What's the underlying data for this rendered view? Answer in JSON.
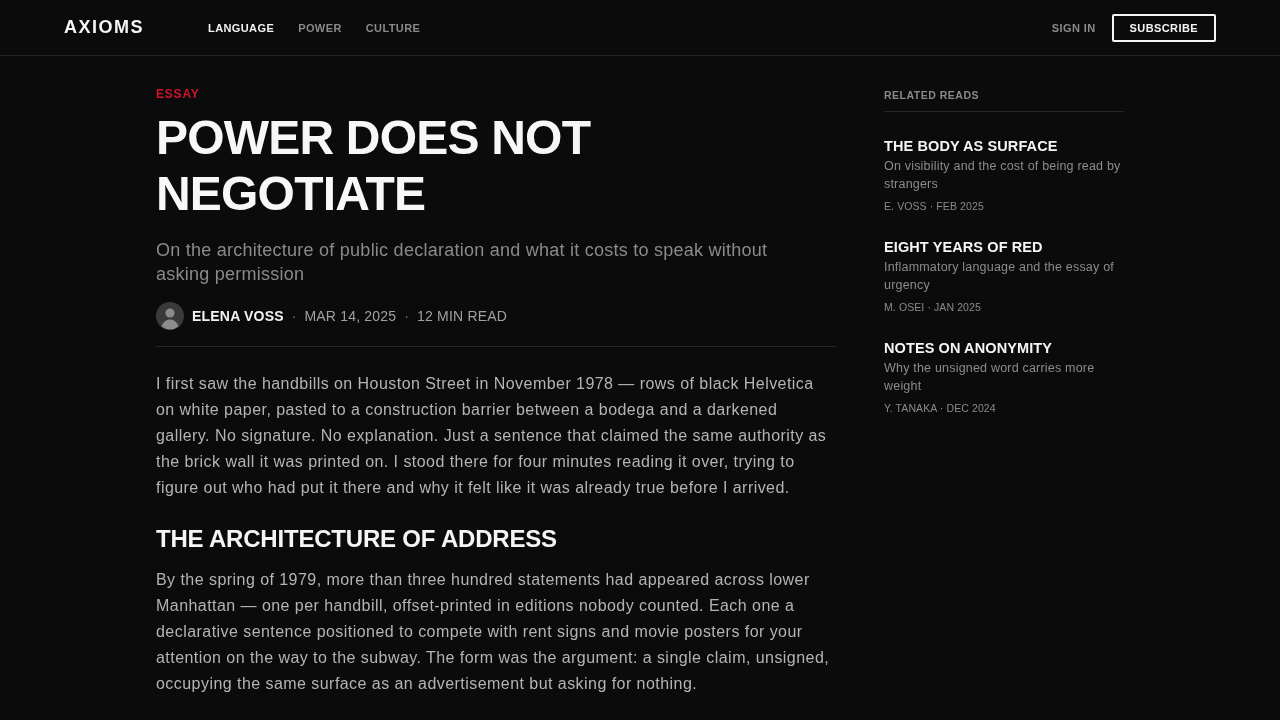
{
  "header": {
    "logo": "AXIOMS",
    "nav": [
      {
        "label": "LANGUAGE",
        "selected": true
      },
      {
        "label": "POWER",
        "selected": false
      },
      {
        "label": "CULTURE",
        "selected": false
      }
    ],
    "sign_in": "SIGN IN",
    "subscribe": "SUBSCRIBE"
  },
  "article": {
    "category": "ESSAY",
    "title": "POWER DOES NOT NEGOTIATE",
    "subtitle": "On the architecture of public declaration and what it costs to speak without asking permission",
    "byline": [
      {
        "kind": "author",
        "text": "ELENA VOSS"
      },
      {
        "kind": "separator",
        "text": "·"
      },
      {
        "kind": "meta",
        "text": "MAR 14, 2025"
      },
      {
        "kind": "separator",
        "text": "·"
      },
      {
        "kind": "meta",
        "text": "12 MIN READ"
      }
    ],
    "body": [
      {
        "kind": "paragraph",
        "text": "I first saw the handbills on Houston Street in November 1978 — rows of black Helvetica on white paper, pasted to a construction barrier between a bodega and a darkened gallery. No signature. No explanation. Just a sentence that claimed the same authority as the brick wall it was printed on. I stood there for four minutes reading it over, trying to figure out who had put it there and why it felt like it was already true before I arrived."
      },
      {
        "kind": "heading",
        "text": "THE ARCHITECTURE OF ADDRESS"
      },
      {
        "kind": "paragraph",
        "text": "By the spring of 1979, more than three hundred statements had appeared across lower Manhattan — one per handbill, offset-printed in editions nobody counted. Each one a declarative sentence positioned to compete with rent signs and movie posters for your attention on the way to the subway. The form was the argument: a single claim, unsigned, occupying the same surface as an advertisement but asking for nothing."
      }
    ]
  },
  "sidebar": {
    "heading": "RELATED READS",
    "items": [
      {
        "title": "THE BODY AS SURFACE",
        "summary": "On visibility and the cost of being read by strangers",
        "meta": "E. VOSS · FEB 2025"
      },
      {
        "title": "EIGHT YEARS OF RED",
        "summary": "Inflammatory language and the essay of urgency",
        "meta": "M. OSEI · JAN 2025"
      },
      {
        "title": "NOTES ON ANONYMITY",
        "summary": "Why the unsigned word carries more weight",
        "meta": "Y. TANAKA · DEC 2024"
      }
    ]
  }
}
